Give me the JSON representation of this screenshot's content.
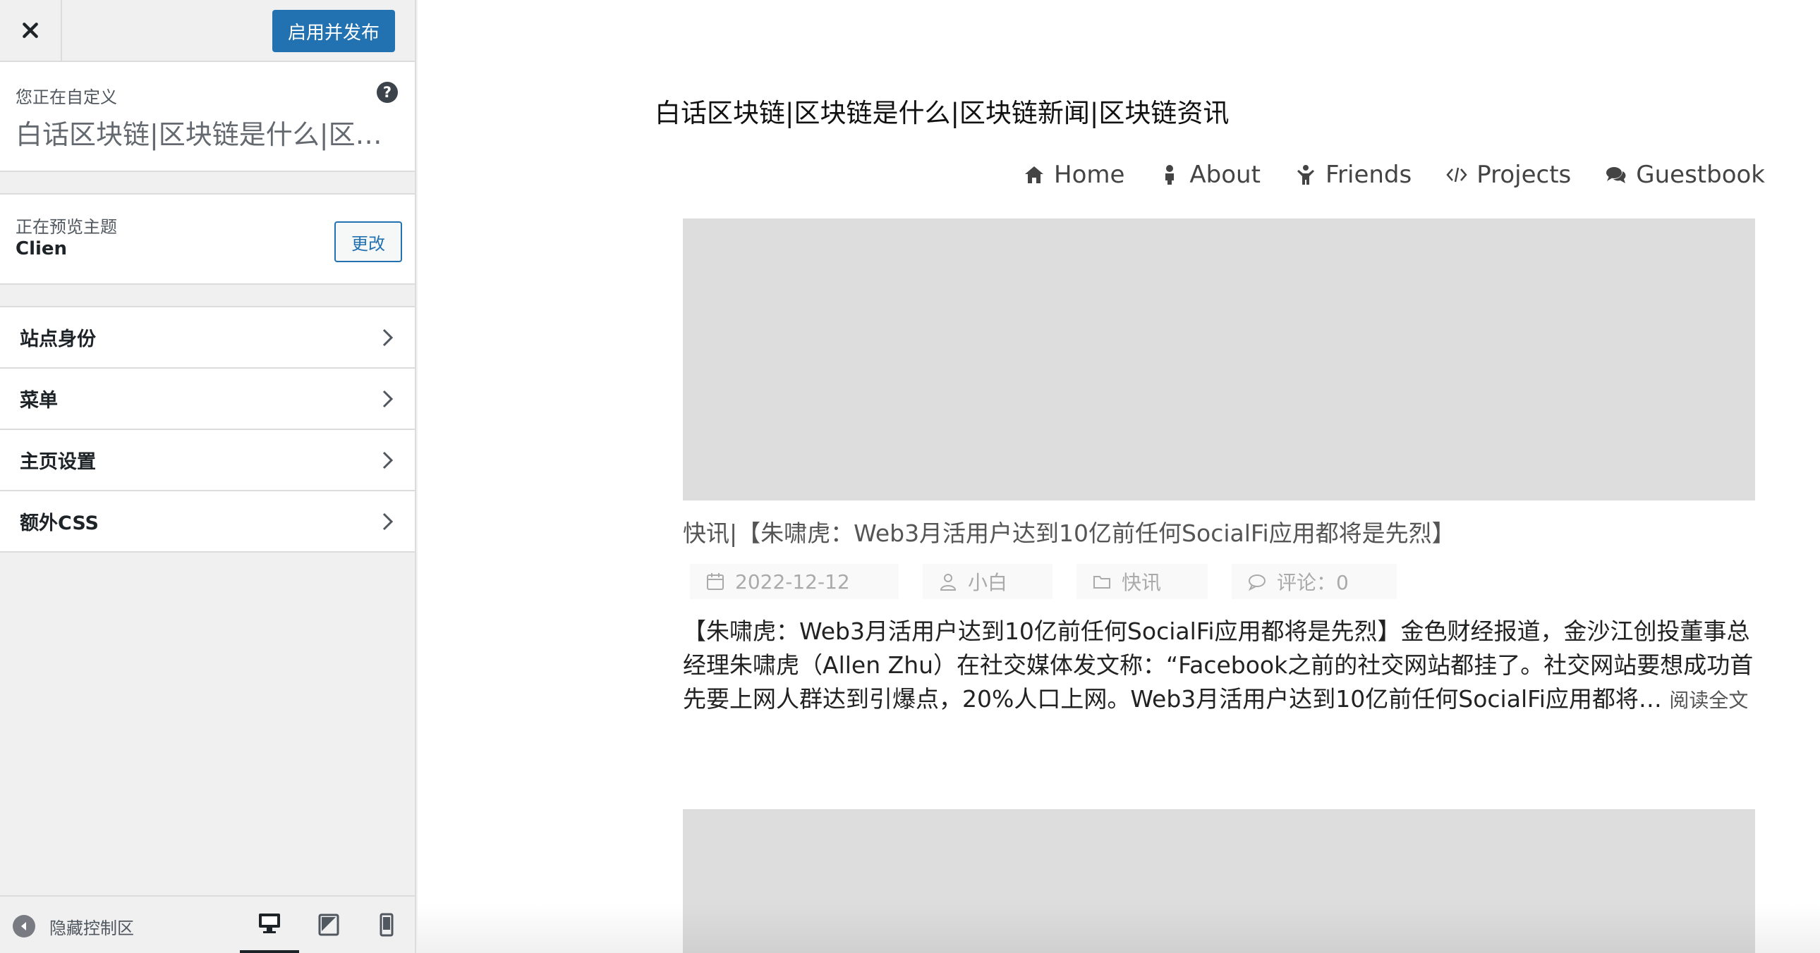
{
  "header": {
    "close_icon": "close-icon",
    "publish_label": "启用并发布",
    "accent_color": "#2271b1"
  },
  "info": {
    "caption": "您正在自定义",
    "site_title": "白话区块链|区块链是什么|区块链新闻|区块链资讯",
    "help_icon": "help-icon",
    "help_glyph": "?"
  },
  "theme": {
    "caption": "正在预览主题",
    "name": "Clien",
    "change_label": "更改"
  },
  "sections": [
    {
      "label": "站点身份"
    },
    {
      "label": "菜单"
    },
    {
      "label": "主页设置"
    },
    {
      "label": "额外CSS"
    }
  ],
  "footer": {
    "collapse_label": "隐藏控制区",
    "devices": [
      "desktop",
      "tablet",
      "mobile"
    ],
    "active_device": "desktop"
  },
  "preview": {
    "site_heading": "白话区块链|区块链是什么|区块链新闻|区块链资讯",
    "nav": [
      {
        "label": "Home",
        "icon": "home-icon"
      },
      {
        "label": "About",
        "icon": "user-icon"
      },
      {
        "label": "Friends",
        "icon": "child-icon"
      },
      {
        "label": "Projects",
        "icon": "code-icon"
      },
      {
        "label": "Guestbook",
        "icon": "comments-icon"
      }
    ],
    "post": {
      "title": "快讯|【朱啸虎：Web3月活用户达到10亿前任何SocialFi应用都将是先烈】",
      "date": "2022-12-12",
      "author": "小白",
      "category": "快讯",
      "comments": "评论：0",
      "excerpt": "【朱啸虎：Web3月活用户达到10亿前任何SocialFi应用都将是先烈】金色财经报道，金沙江创投董事总经理朱啸虎（Allen Zhu）在社交媒体发文称：“Facebook之前的社交网站都挂了。社交网站要想成功首先要上网人群达到引爆点，20%人口上网。Web3月活用户达到10亿前任何SocialFi应用都将… ",
      "read_more": "阅读全文"
    }
  }
}
